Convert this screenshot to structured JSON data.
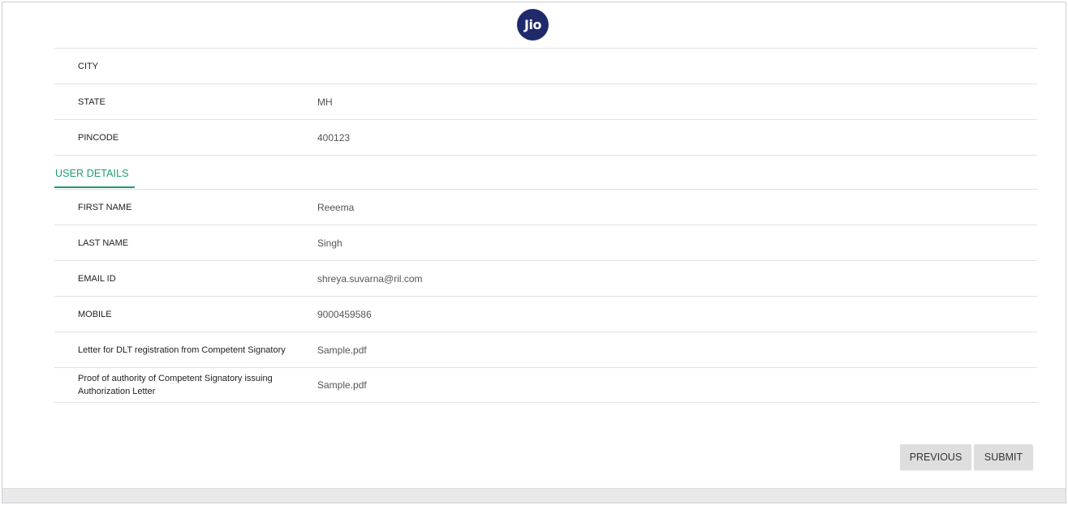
{
  "logo": {
    "text": "Jio",
    "color": "#1f2a6b"
  },
  "address_rows": [
    {
      "label": "CITY",
      "value": ""
    },
    {
      "label": "STATE",
      "value": "MH"
    },
    {
      "label": "PINCODE",
      "value": "400123"
    }
  ],
  "user_section": {
    "title": "USER DETAILS",
    "accent": "#1d9c73"
  },
  "user_rows": [
    {
      "label": "FIRST NAME",
      "value": "Reeema"
    },
    {
      "label": "LAST NAME",
      "value": "Singh"
    },
    {
      "label": "EMAIL ID",
      "value": "shreya.suvarna@ril.com"
    },
    {
      "label": "MOBILE",
      "value": "9000459586"
    },
    {
      "label": "Letter for DLT registration from Competent Signatory",
      "value": "Sample.pdf"
    },
    {
      "label": "Proof of authority of Competent Signatory issuing Authorization Letter",
      "value": "Sample.pdf"
    }
  ],
  "actions": {
    "previous_label": "PREVIOUS",
    "submit_label": "SUBMIT"
  }
}
